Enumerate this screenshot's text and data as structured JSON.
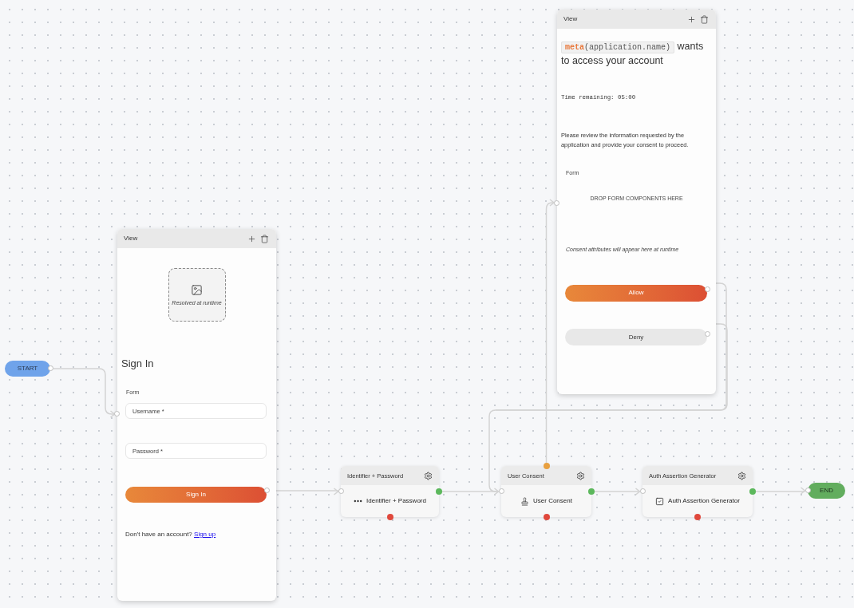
{
  "canvas": {
    "start": {
      "label": "START"
    },
    "sign_in_view": {
      "header": "View",
      "image_caption": "Resolved at runtime",
      "heading": "Sign In",
      "form_label": "Form",
      "fields": [
        {
          "placeholder": "Username *"
        },
        {
          "placeholder": "Password *"
        }
      ],
      "submit": "Sign In",
      "footer_text": "Don't have an account?",
      "footer_link": "Sign up"
    },
    "consent_view": {
      "header": "View",
      "code": "**meta**(application.name)",
      "heading": "wants to access your account",
      "timer": "Time remaining: 05:00",
      "description": "Please review the information requested by the application and provide your consent to proceed.",
      "form_label": "Form",
      "drop_hint": "DROP FORM COMPONENTS HERE",
      "attributes_note": "Consent attributes will appear here at runtime",
      "buttons": [
        {
          "label": "Allow",
          "kind": "primary"
        },
        {
          "label": "Deny",
          "kind": "secondary"
        }
      ]
    },
    "steps": [
      {
        "kind": "password",
        "title": "Identifier + Password",
        "label": "Identifier + Password",
        "view_port": false
      },
      {
        "kind": "consent",
        "title": "User Consent",
        "label": "User Consent",
        "view_port": true
      },
      {
        "kind": "assertion",
        "title": "Auth Assertion Generator",
        "label": "Auth Assertion Generator",
        "view_port": false
      }
    ],
    "end": {
      "label": "END"
    }
  }
}
